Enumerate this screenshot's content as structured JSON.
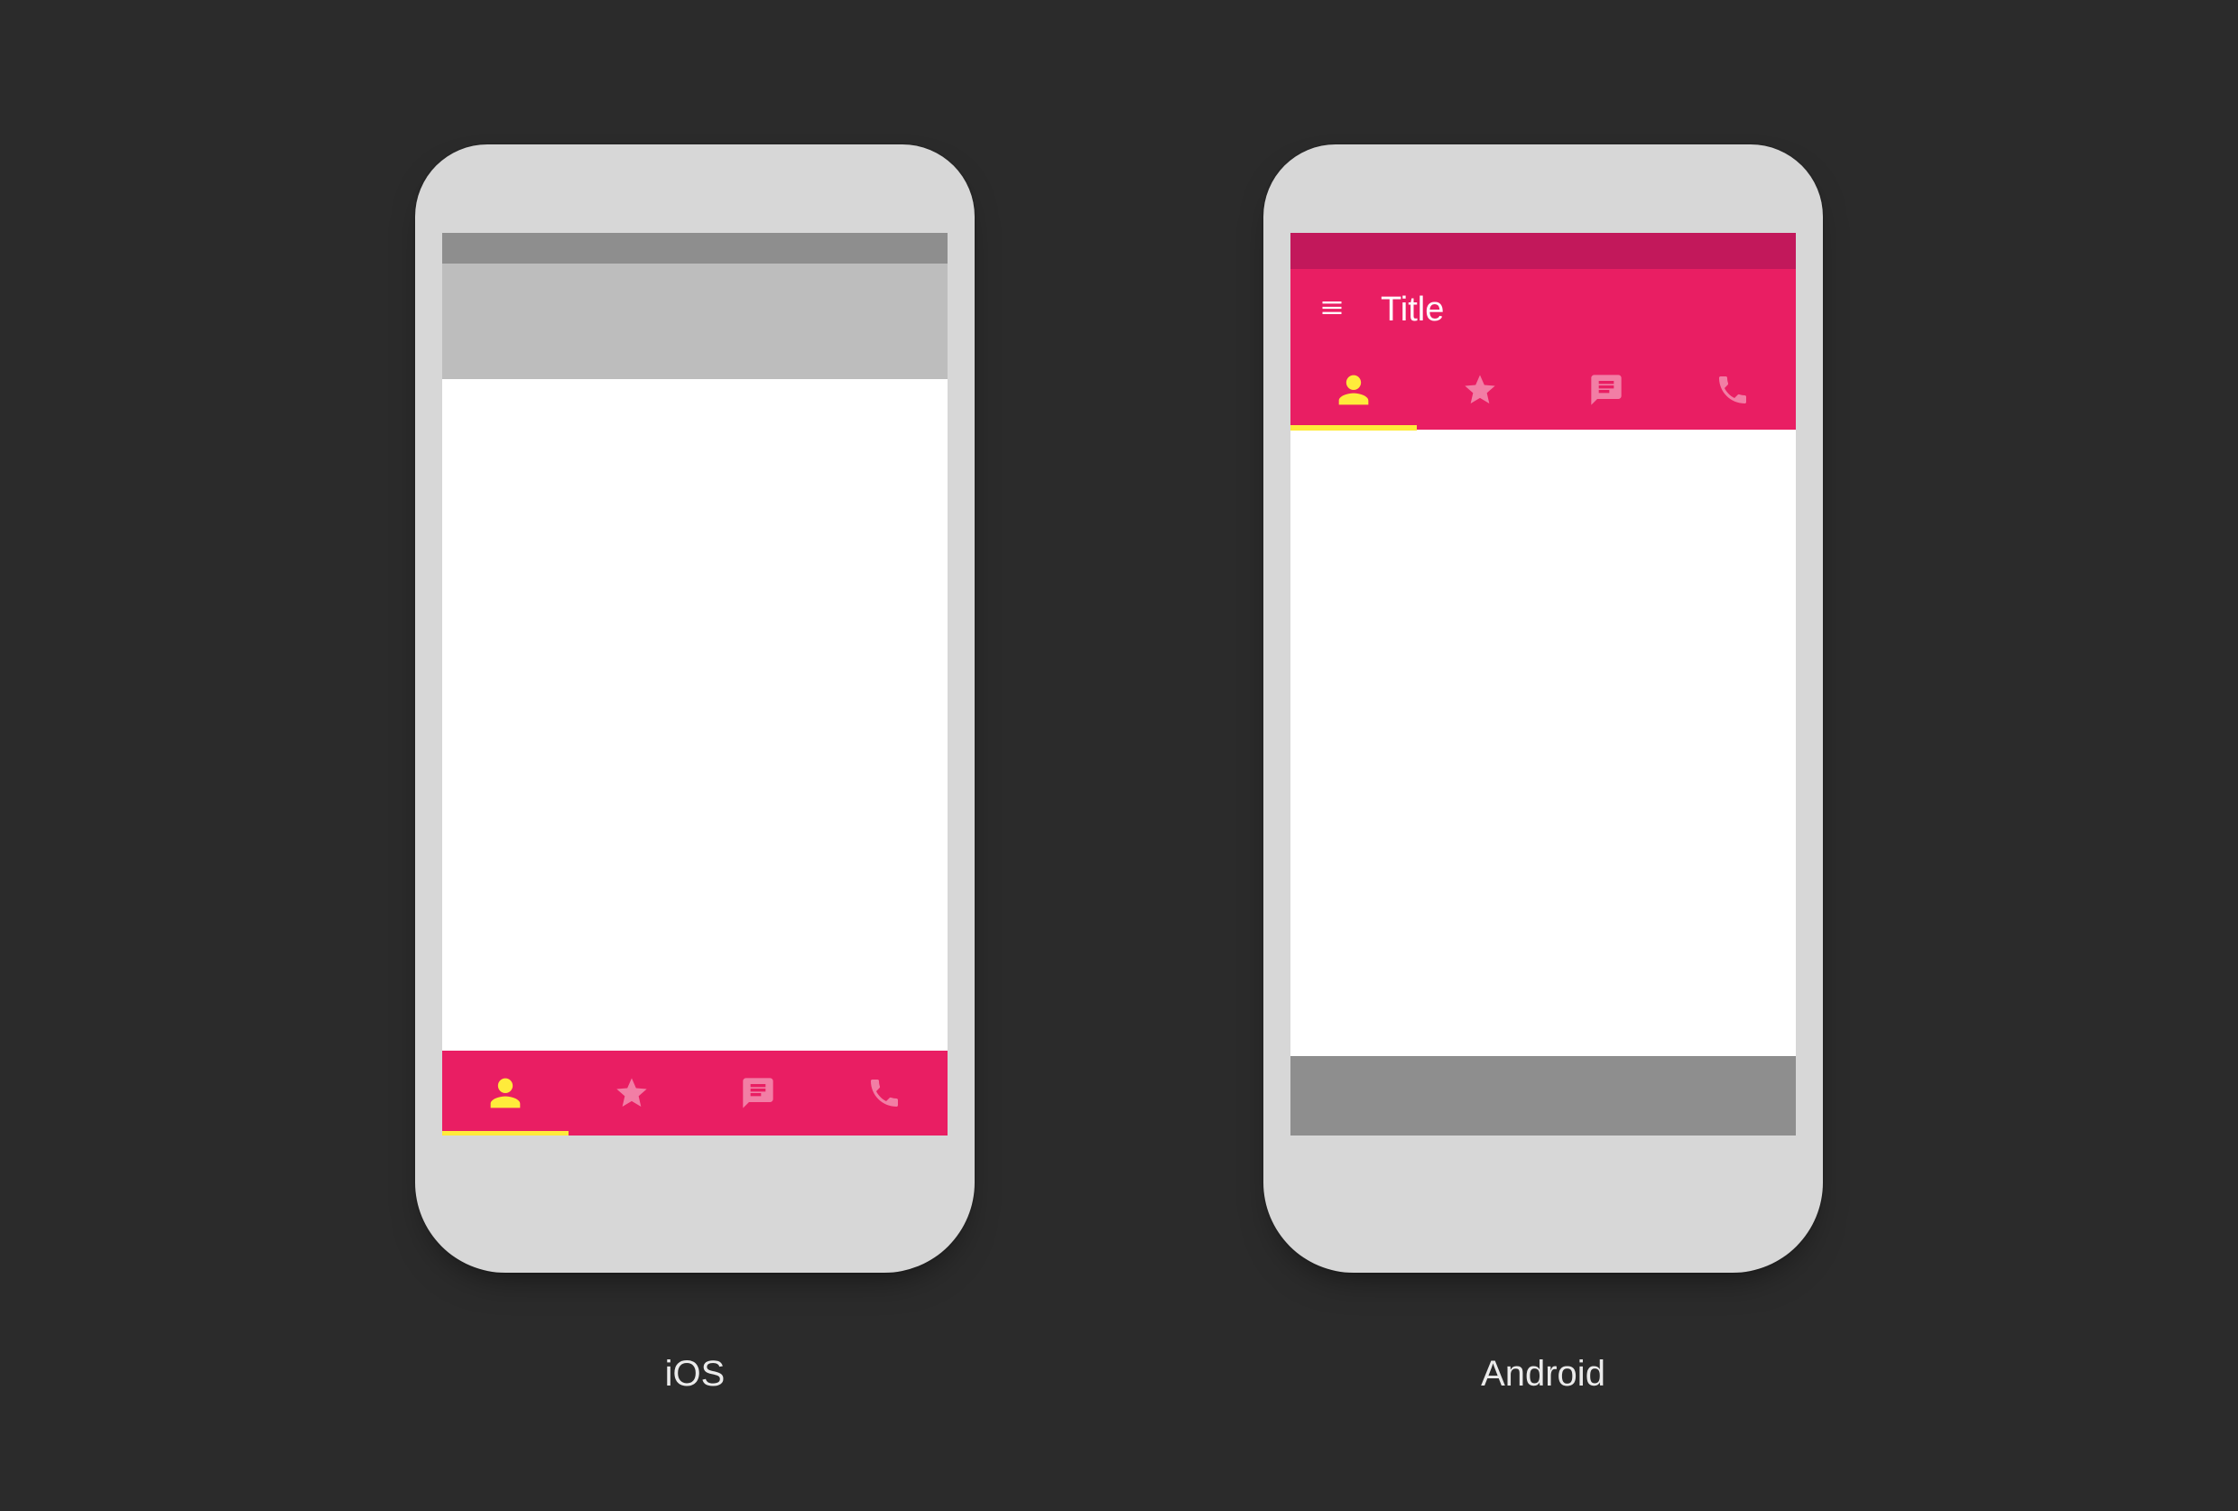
{
  "colors": {
    "background": "#2B2B2B",
    "device_body": "#D7D7D7",
    "accent": "#E91E63",
    "accent_dark": "#C2185B",
    "active_icon": "#FFEB3B",
    "inactive_icon": "#F48FB1",
    "ios_statusbar": "#8E8E8E",
    "ios_toolbar": "#BDBDBD",
    "android_navbar": "#8E8E8E",
    "content_bg": "#FFFFFF",
    "caption_text": "#EBEBEB"
  },
  "captions": {
    "left": "iOS",
    "right": "Android"
  },
  "ios": {
    "tabs": [
      {
        "icon": "person-icon",
        "active": true
      },
      {
        "icon": "star-icon",
        "active": false
      },
      {
        "icon": "chat-icon",
        "active": false
      },
      {
        "icon": "phone-icon",
        "active": false
      }
    ]
  },
  "android": {
    "appbar": {
      "menu_icon": "menu-icon",
      "title": "Title"
    },
    "tabs": [
      {
        "icon": "person-icon",
        "active": true
      },
      {
        "icon": "star-icon",
        "active": false
      },
      {
        "icon": "chat-icon",
        "active": false
      },
      {
        "icon": "phone-icon",
        "active": false
      }
    ]
  }
}
